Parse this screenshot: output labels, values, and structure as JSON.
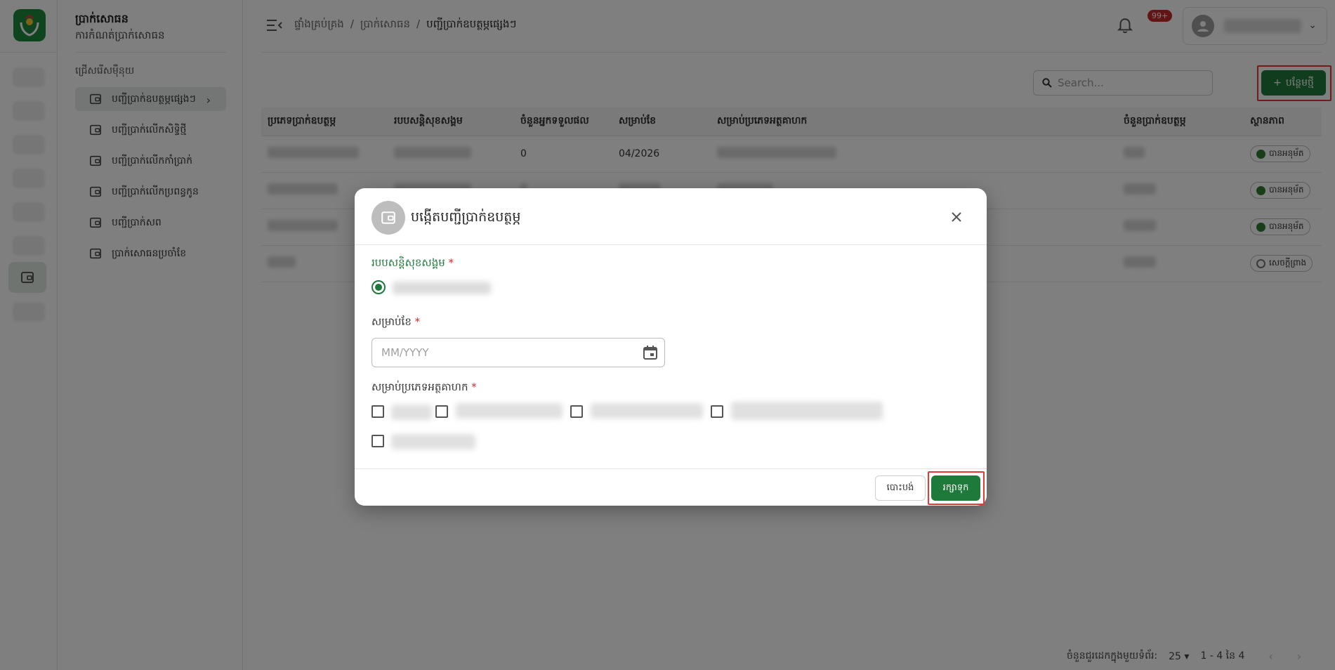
{
  "app": {
    "title": "ប្រាក់សោធន",
    "subtitle": "ការកំណត់ប្រាក់សោធន",
    "menu_group": "ជ្រើសរើសម៉ឺនុយ"
  },
  "sidebar": {
    "items": [
      {
        "label": "បញ្ជីប្រាក់ឧបត្ថម្ភផ្សេងៗ",
        "active": true
      },
      {
        "label": "បញ្ជីប្រាក់លើកសិទ្ធិថ្មី"
      },
      {
        "label": "បញ្ជីប្រាក់លើកកាំប្រាក់"
      },
      {
        "label": "បញ្ជីប្រាក់លើកប្រពន្ធកូន"
      },
      {
        "label": "បញ្ជីប្រាក់សព"
      },
      {
        "label": "ប្រាក់សោធនប្រចាំខែ"
      }
    ]
  },
  "breadcrumb": {
    "home": "ផ្ទាំងគ្រប់គ្រង",
    "section": "ប្រាក់សោធន",
    "current": "បញ្ជីប្រាក់ឧបត្ថម្ភផ្សេងៗ",
    "sep": "/"
  },
  "header": {
    "notification_count": "99+"
  },
  "toolbar": {
    "search_placeholder": "Search...",
    "add_label": "បន្ថែមថ្មី"
  },
  "table": {
    "columns": [
      "ប្រភេទប្រាក់ឧបត្ថម្ភ",
      "របបសន្តិសុខសង្គម",
      "ចំនួនអ្នកទទួលផល",
      "សម្រាប់ខែ",
      "សម្រាប់ប្រភេទអត្ថគាហក",
      "ចំនួនប្រាក់ឧបត្ថម្ភ",
      "ស្ថានភាព"
    ],
    "rows": [
      {
        "beneficiaries": "0",
        "month": "04/2026",
        "status": "បានអនុម័ត",
        "status_kind": "approved"
      },
      {
        "beneficiaries": "",
        "month": "",
        "status": "បានអនុម័ត",
        "status_kind": "approved"
      },
      {
        "beneficiaries": "",
        "month": "",
        "status": "បានអនុម័ត",
        "status_kind": "approved"
      },
      {
        "beneficiaries": "",
        "month": "",
        "status": "សេចក្តីព្រាង",
        "status_kind": "draft"
      }
    ]
  },
  "pagination": {
    "rows_per_page_label": "ចំនួនជួរដេកក្នុងមួយទំព័រ:",
    "rows_per_page": "25",
    "range": "1 - 4 នៃ 4"
  },
  "modal": {
    "title": "បង្កើតបញ្ជីប្រាក់ឧបត្ថម្ភ",
    "scheme_label": "របបសន្តិសុខសង្គម",
    "month_label": "សម្រាប់ខែ",
    "month_placeholder": "MM/YYYY",
    "type_label": "សម្រាប់ប្រភេទអត្ថគាហក",
    "required_mark": "*",
    "cancel_label": "បោះបង់",
    "save_label": "រក្សាទុក"
  },
  "colors": {
    "primary": "#1e7a3b",
    "highlight": "#e53935",
    "badge": "#c62828"
  }
}
